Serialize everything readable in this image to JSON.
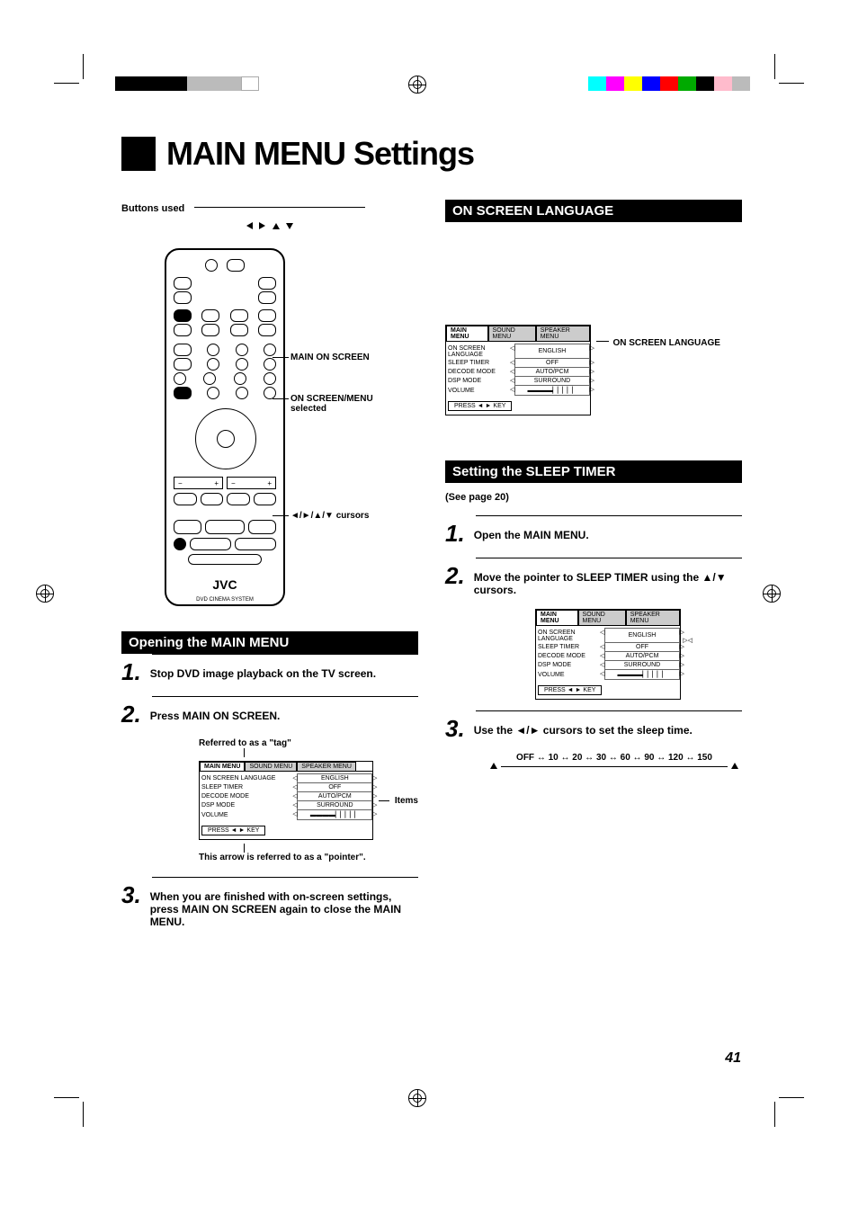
{
  "page": {
    "title": "MAIN MENU Settings",
    "number": "41"
  },
  "left": {
    "buttons_used": "Buttons used",
    "callouts": {
      "main_on_screen": "MAIN ON SCREEN",
      "on_screen_menu_selected": "ON SCREEN/MENU selected",
      "cursors": "◄/►/▲/▼ cursors"
    },
    "remote": {
      "brand": "JVC",
      "label": "DVD CINEMA SYSTEM"
    },
    "section_open": "Opening the MAIN MENU",
    "step1": "Stop DVD image playback on the TV screen.",
    "step2": "Press MAIN ON SCREEN.",
    "tag_note": "Referred to as a \"tag\"",
    "items_label": "Items",
    "pointer_note": "This arrow is referred to as a \"pointer\".",
    "step3": "When you are finished with on-screen settings, press MAIN ON SCREEN again to close the MAIN MENU."
  },
  "right": {
    "section_lang": "ON SCREEN LANGUAGE",
    "lang_callout": "ON SCREEN LANGUAGE",
    "section_sleep": "Setting the SLEEP TIMER",
    "see_page": "(See page 20)",
    "sleep_step1": "Open the MAIN MENU.",
    "sleep_step2": "Move the pointer to SLEEP TIMER using the ▲/▼ cursors.",
    "sleep_step3": "Use the ◄/► cursors to set the sleep time.",
    "sleep_values": "OFF ↔ 10 ↔ 20 ↔ 30 ↔ 60 ↔ 90 ↔ 120 ↔ 150"
  },
  "osd": {
    "tabs": [
      "MAIN MENU",
      "SOUND MENU",
      "SPEAKER MENU"
    ],
    "rows": [
      {
        "label": "ON SCREEN LANGUAGE",
        "value": "ENGLISH"
      },
      {
        "label": "SLEEP TIMER",
        "value": "OFF"
      },
      {
        "label": "DECODE MODE",
        "value": "AUTO/PCM"
      },
      {
        "label": "DSP MODE",
        "value": "SURROUND"
      },
      {
        "label": "VOLUME",
        "value": "▬▬▬▬▏▏▏▏▏"
      }
    ],
    "hint": "PRESS ◄ ► KEY"
  }
}
